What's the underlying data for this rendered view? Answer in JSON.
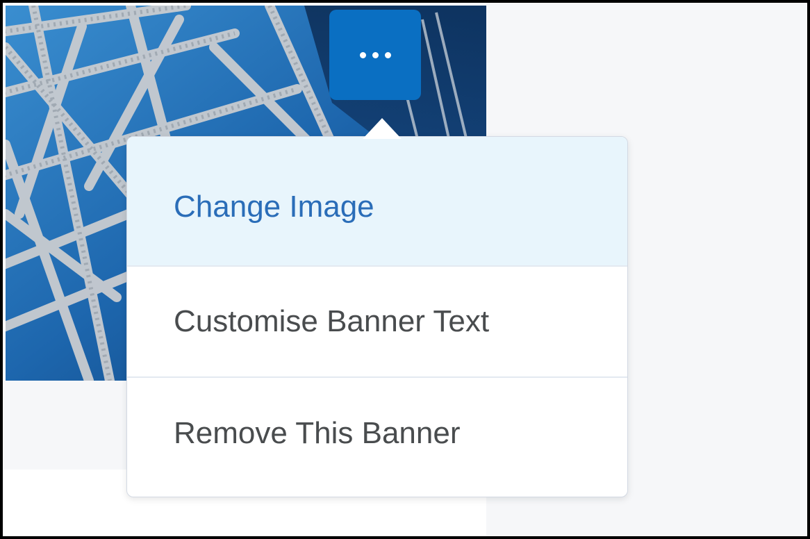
{
  "banner": {
    "more_button_label": "More options",
    "more_button_icon": "ellipsis-icon"
  },
  "menu": {
    "items": [
      {
        "label": "Change Image",
        "state": "highlighted"
      },
      {
        "label": "Customise Banner Text",
        "state": "normal"
      },
      {
        "label": "Remove This Banner",
        "state": "normal"
      }
    ]
  },
  "colors": {
    "accent": "#0a6fc2",
    "highlight_bg": "#e8f5fc",
    "highlight_text": "#2a6db8",
    "menu_text": "#494c4e",
    "panel_bg": "#f6f7f9"
  }
}
